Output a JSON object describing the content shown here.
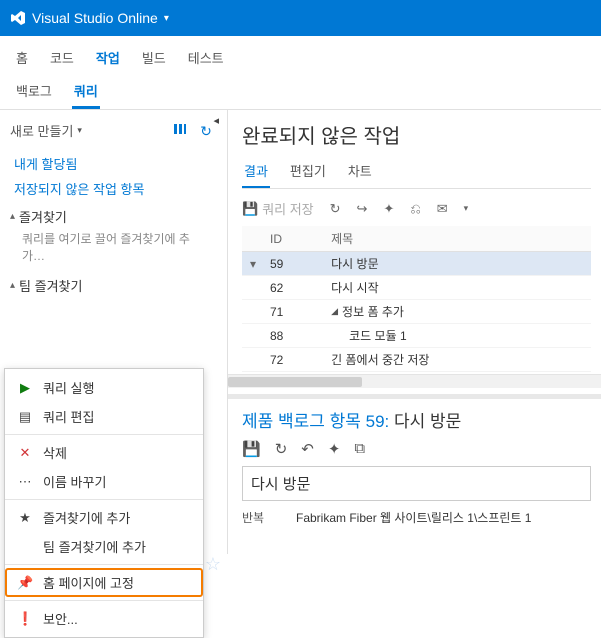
{
  "app": {
    "title": "Visual Studio Online"
  },
  "nav1": {
    "home": "홈",
    "code": "코드",
    "work": "작업",
    "build": "빌드",
    "test": "테스트"
  },
  "nav2": {
    "backlog": "백로그",
    "queries": "쿼리"
  },
  "sidebar": {
    "new": "새로 만들기",
    "assigned_to_me": "내게 할당됨",
    "unsaved_work_items": "저장되지 않은 작업 항목",
    "favorites": "즐겨찾기",
    "favorites_hint": "쿼리를 여기로 끌어 즐겨찾기에 추가…",
    "team_favorites": "팀 즐겨찾기"
  },
  "context_menu": {
    "run": "쿼리 실행",
    "edit": "쿼리 편집",
    "delete": "삭제",
    "rename": "이름 바꾸기",
    "add_fav": "즐겨찾기에 추가",
    "add_team_fav": "팀 즐겨찾기에 추가",
    "pin_home": "홈 페이지에 고정",
    "security": "보안..."
  },
  "content": {
    "title": "완료되지 않은 작업",
    "subtabs": {
      "results": "결과",
      "editor": "편집기",
      "charts": "차트"
    },
    "toolbar": {
      "save_query": "쿼리 저장"
    },
    "columns": {
      "id": "ID",
      "title": "제목"
    },
    "rows": [
      {
        "id": "59",
        "title": "다시 방문",
        "selected": true,
        "expander": "▾"
      },
      {
        "id": "62",
        "title": "다시 시작"
      },
      {
        "id": "71",
        "title": "정보 폼 추가",
        "group": true
      },
      {
        "id": "88",
        "title": "코드 모듈 1",
        "indent": true
      },
      {
        "id": "72",
        "title": "긴 폼에서 중간 저장"
      }
    ]
  },
  "detail": {
    "heading_prefix": "제품 백로그 항목 59:",
    "heading_title": "다시 방문",
    "item_title": "다시 방문",
    "iteration_label": "반복",
    "iteration_value": "Fabrikam Fiber 웹 사이트\\릴리스 1\\스프린트 1"
  }
}
